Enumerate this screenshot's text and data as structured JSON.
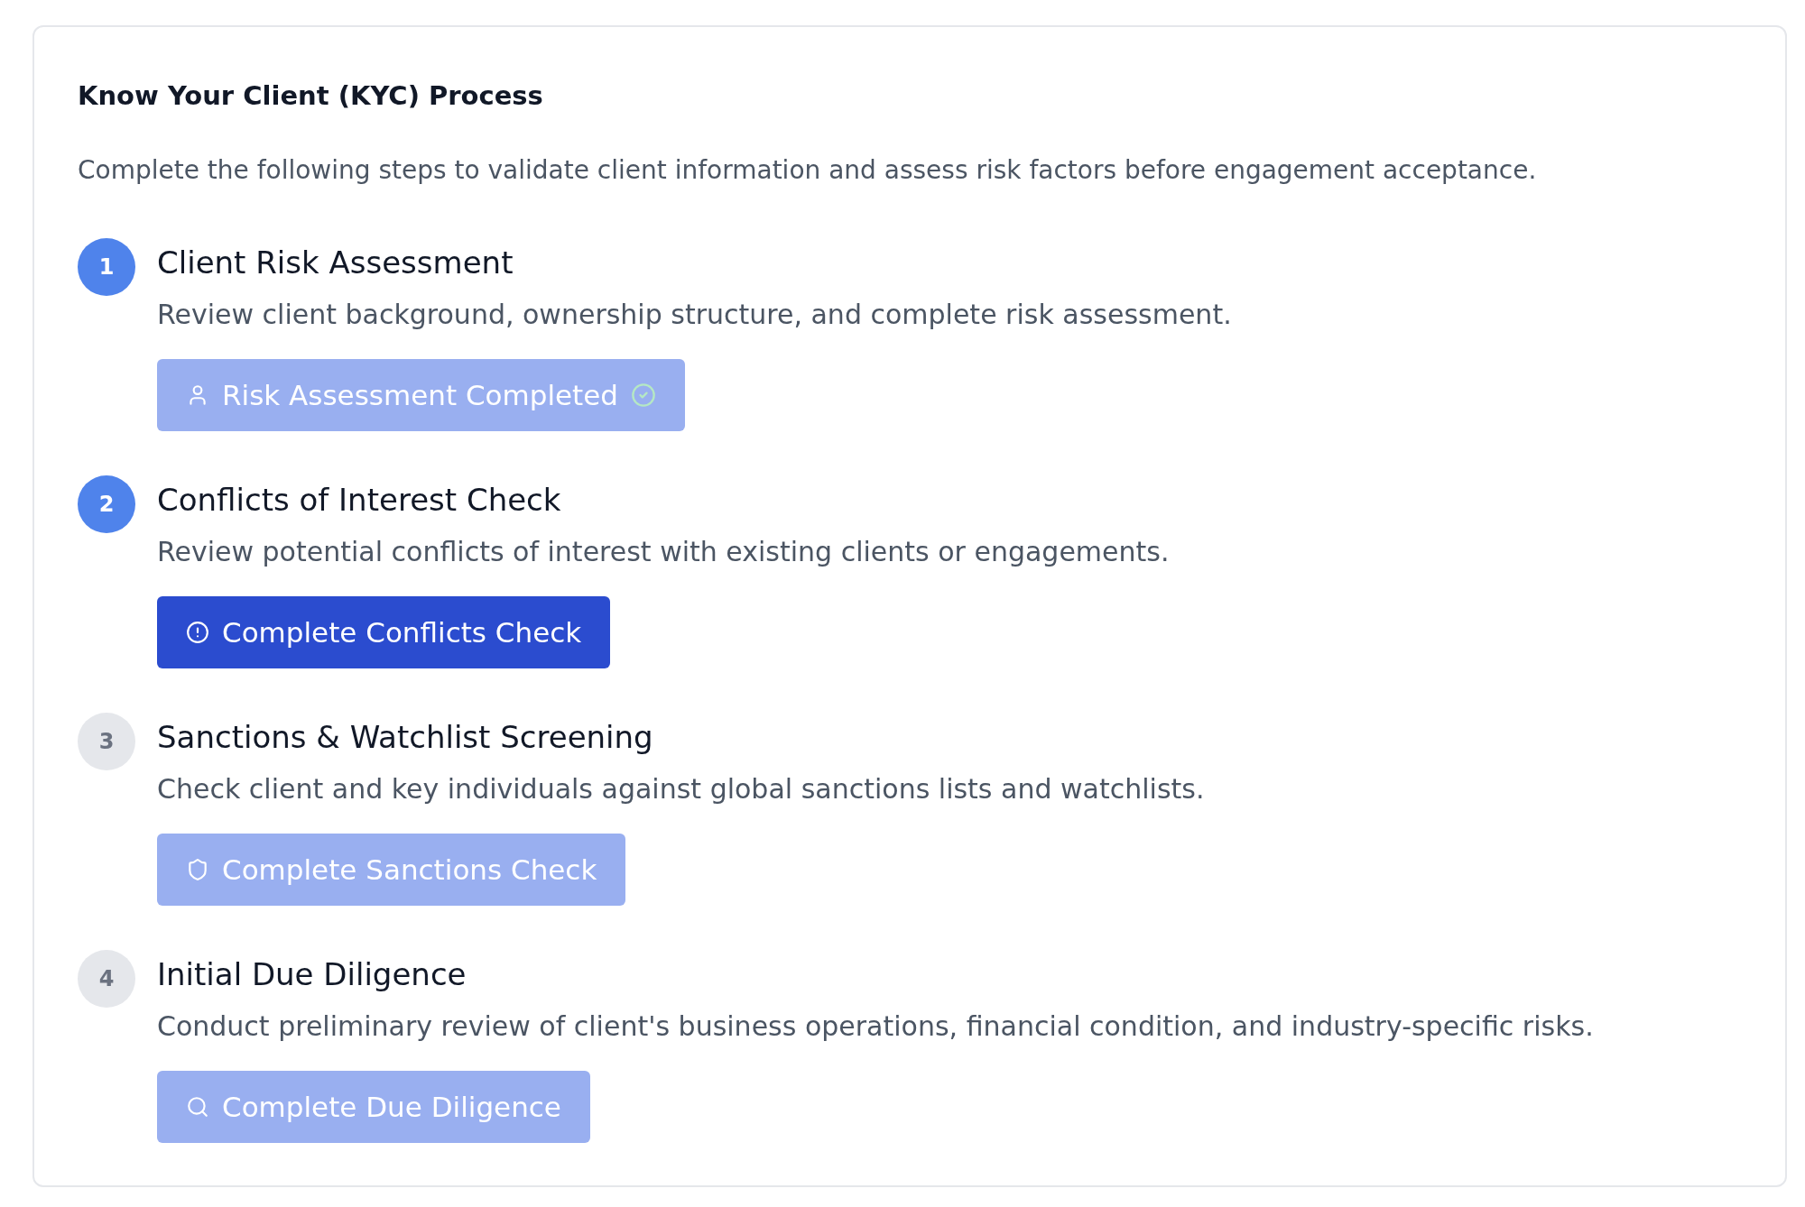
{
  "title": "Know Your Client (KYC) Process",
  "intro": "Complete the following steps to validate client information and assess risk factors before engagement acceptance.",
  "steps": [
    {
      "number": "1",
      "title": "Client Risk Assessment",
      "description": "Review client background, ownership structure, and complete risk assessment.",
      "active": true,
      "button": {
        "label": "Risk Assessment Completed",
        "disabled": true,
        "completed": true
      }
    },
    {
      "number": "2",
      "title": "Conflicts of Interest Check",
      "description": "Review potential conflicts of interest with existing clients or engagements.",
      "active": true,
      "button": {
        "label": "Complete Conflicts Check",
        "disabled": false,
        "completed": false
      }
    },
    {
      "number": "3",
      "title": "Sanctions & Watchlist Screening",
      "description": "Check client and key individuals against global sanctions lists and watchlists.",
      "active": false,
      "button": {
        "label": "Complete Sanctions Check",
        "disabled": true,
        "completed": false
      }
    },
    {
      "number": "4",
      "title": "Initial Due Diligence",
      "description": "Conduct preliminary review of client's business operations, financial condition, and industry-specific risks.",
      "active": false,
      "button": {
        "label": "Complete Due Diligence",
        "disabled": true,
        "completed": false
      }
    }
  ]
}
